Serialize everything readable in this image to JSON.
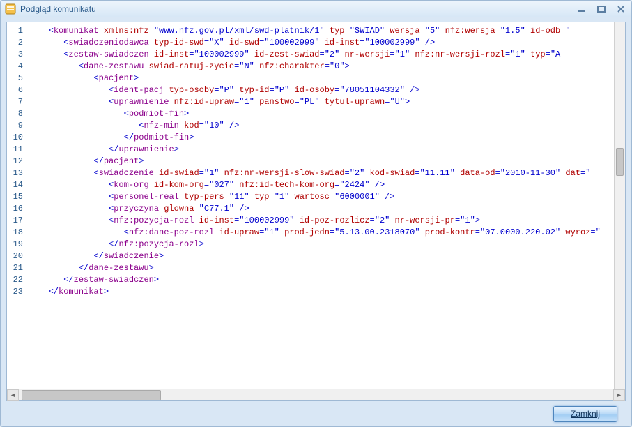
{
  "window": {
    "title": "Podgląd komunikatu"
  },
  "buttons": {
    "close_label": "Zamknij",
    "close_mnemonic": "Z"
  },
  "code": {
    "lines": [
      [
        {
          "indent": 1
        },
        {
          "t": "open",
          "name": "komunikat",
          "attrs": [
            [
              "xmlns:nfz",
              "www.nfz.gov.pl/xml/swd-platnik/1"
            ],
            [
              "typ",
              "SWIAD"
            ],
            [
              "wersja",
              "5"
            ],
            [
              "nfz:wersja",
              "1.5"
            ],
            [
              "id-odb",
              ""
            ]
          ],
          "truncated": true
        }
      ],
      [
        {
          "indent": 2
        },
        {
          "t": "self",
          "name": "swiadczeniodawca",
          "attrs": [
            [
              "typ-id-swd",
              "X"
            ],
            [
              "id-swd",
              "100002999"
            ],
            [
              "id-inst",
              "100002999"
            ]
          ]
        }
      ],
      [
        {
          "indent": 2
        },
        {
          "t": "open",
          "name": "zestaw-swiadczen",
          "attrs": [
            [
              "id-inst",
              "100002999"
            ],
            [
              "id-zest-swiad",
              "2"
            ],
            [
              "nr-wersji",
              "1"
            ],
            [
              "nfz:nr-wersji-rozl",
              "1"
            ],
            [
              "typ",
              "A"
            ]
          ],
          "truncated": true
        }
      ],
      [
        {
          "indent": 3
        },
        {
          "t": "open",
          "name": "dane-zestawu",
          "attrs": [
            [
              "swiad-ratuj-zycie",
              "N"
            ],
            [
              "nfz:charakter",
              "0"
            ]
          ]
        }
      ],
      [
        {
          "indent": 4
        },
        {
          "t": "open",
          "name": "pacjent",
          "attrs": []
        }
      ],
      [
        {
          "indent": 5
        },
        {
          "t": "self",
          "name": "ident-pacj",
          "attrs": [
            [
              "typ-osoby",
              "P"
            ],
            [
              "typ-id",
              "P"
            ],
            [
              "id-osoby",
              "78051104332"
            ]
          ]
        }
      ],
      [
        {
          "indent": 5
        },
        {
          "t": "open",
          "name": "uprawnienie",
          "attrs": [
            [
              "nfz:id-upraw",
              "1"
            ],
            [
              "panstwo",
              "PL"
            ],
            [
              "tytul-uprawn",
              "U"
            ]
          ]
        }
      ],
      [
        {
          "indent": 6
        },
        {
          "t": "open",
          "name": "podmiot-fin",
          "attrs": []
        }
      ],
      [
        {
          "indent": 7
        },
        {
          "t": "self",
          "name": "nfz-min",
          "attrs": [
            [
              "kod",
              "10"
            ]
          ]
        }
      ],
      [
        {
          "indent": 6
        },
        {
          "t": "close",
          "name": "podmiot-fin"
        }
      ],
      [
        {
          "indent": 5
        },
        {
          "t": "close",
          "name": "uprawnienie"
        }
      ],
      [
        {
          "indent": 4
        },
        {
          "t": "close",
          "name": "pacjent"
        }
      ],
      [
        {
          "indent": 4
        },
        {
          "t": "open",
          "name": "swiadczenie",
          "attrs": [
            [
              "id-swiad",
              "1"
            ],
            [
              "nfz:nr-wersji-slow-swiad",
              "2"
            ],
            [
              "kod-swiad",
              "11.11"
            ],
            [
              "data-od",
              "2010-11-30"
            ],
            [
              "dat",
              ""
            ]
          ],
          "truncated": true
        }
      ],
      [
        {
          "indent": 5
        },
        {
          "t": "self",
          "name": "kom-org",
          "attrs": [
            [
              "id-kom-org",
              "027"
            ],
            [
              "nfz:id-tech-kom-org",
              "2424"
            ]
          ]
        }
      ],
      [
        {
          "indent": 5
        },
        {
          "t": "self",
          "name": "personel-real",
          "attrs": [
            [
              "typ-pers",
              "11"
            ],
            [
              "typ",
              "1"
            ],
            [
              "wartosc",
              "6000001"
            ]
          ]
        }
      ],
      [
        {
          "indent": 5
        },
        {
          "t": "self",
          "name": "przyczyna",
          "attrs": [
            [
              "glowna",
              "C77.1"
            ]
          ]
        }
      ],
      [
        {
          "indent": 5
        },
        {
          "t": "open",
          "name": "nfz:pozycja-rozl",
          "attrs": [
            [
              "id-inst",
              "100002999"
            ],
            [
              "id-poz-rozlicz",
              "2"
            ],
            [
              "nr-wersji-pr",
              "1"
            ]
          ]
        }
      ],
      [
        {
          "indent": 6
        },
        {
          "t": "open",
          "name": "nfz:dane-poz-rozl",
          "attrs": [
            [
              "id-upraw",
              "1"
            ],
            [
              "prod-jedn",
              "5.13.00.2318070"
            ],
            [
              "prod-kontr",
              "07.0000.220.02"
            ],
            [
              "wyroz",
              ""
            ]
          ],
          "truncated": true
        }
      ],
      [
        {
          "indent": 5
        },
        {
          "t": "close",
          "name": "nfz:pozycja-rozl"
        }
      ],
      [
        {
          "indent": 4
        },
        {
          "t": "close",
          "name": "swiadczenie"
        }
      ],
      [
        {
          "indent": 3
        },
        {
          "t": "close",
          "name": "dane-zestawu"
        }
      ],
      [
        {
          "indent": 2
        },
        {
          "t": "close",
          "name": "zestaw-swiadczen"
        }
      ],
      [
        {
          "indent": 1
        },
        {
          "t": "close",
          "name": "komunikat"
        }
      ]
    ]
  }
}
